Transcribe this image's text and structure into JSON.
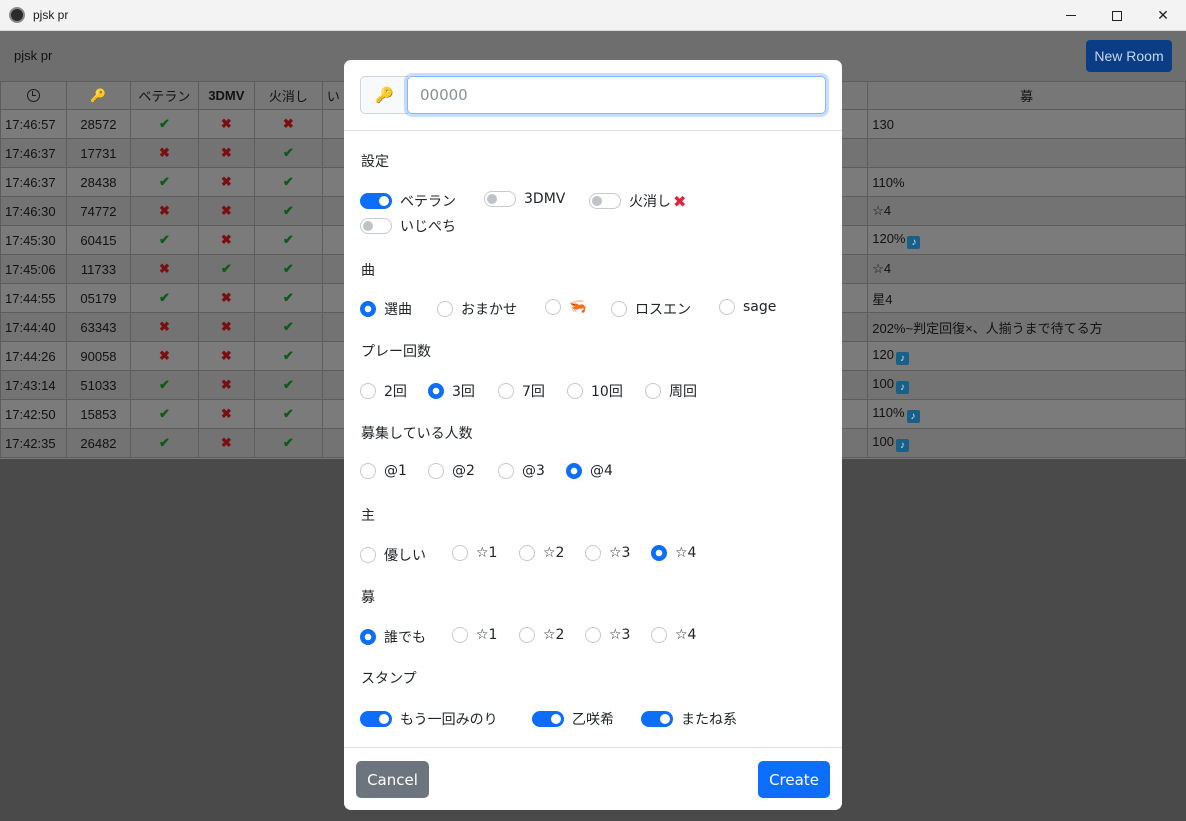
{
  "window": {
    "title": "pjsk pr"
  },
  "appbar": {
    "brand": "pjsk pr",
    "new_room_label": "New Room"
  },
  "table": {
    "headers": [
      "",
      "",
      "ベテラン",
      "3DMV",
      "火消し",
      "い",
      "募"
    ],
    "rows": [
      {
        "time": "17:46:57",
        "key": "28572",
        "veteran": true,
        "mv": false,
        "fire": false,
        "note": "130",
        "badge": false
      },
      {
        "time": "17:46:37",
        "key": "17731",
        "veteran": false,
        "mv": false,
        "fire": true,
        "note": "",
        "badge": false
      },
      {
        "time": "17:46:37",
        "key": "28438",
        "veteran": true,
        "mv": false,
        "fire": true,
        "note": "110%",
        "badge": false
      },
      {
        "time": "17:46:30",
        "key": "74772",
        "veteran": false,
        "mv": false,
        "fire": true,
        "note": "☆4",
        "badge": false
      },
      {
        "time": "17:45:30",
        "key": "60415",
        "veteran": true,
        "mv": false,
        "fire": true,
        "note": "120%",
        "badge": true
      },
      {
        "time": "17:45:06",
        "key": "11733",
        "veteran": false,
        "mv": true,
        "fire": true,
        "note": "☆4",
        "badge": false
      },
      {
        "time": "17:44:55",
        "key": "05179",
        "veteran": true,
        "mv": false,
        "fire": true,
        "note": "星4",
        "badge": false
      },
      {
        "time": "17:44:40",
        "key": "63343",
        "veteran": false,
        "mv": false,
        "fire": true,
        "note": "202%~判定回復×、人揃うまで待てる方",
        "badge": false
      },
      {
        "time": "17:44:26",
        "key": "90058",
        "veteran": false,
        "mv": false,
        "fire": true,
        "note": "120",
        "badge": true
      },
      {
        "time": "17:43:14",
        "key": "51033",
        "veteran": true,
        "mv": false,
        "fire": true,
        "note": "100",
        "badge": true
      },
      {
        "time": "17:42:50",
        "key": "15853",
        "veteran": true,
        "mv": false,
        "fire": true,
        "note": "110%",
        "badge": true
      },
      {
        "time": "17:42:35",
        "key": "26482",
        "veteran": true,
        "mv": false,
        "fire": true,
        "note": "100",
        "badge": true
      }
    ]
  },
  "modal": {
    "key_input": {
      "value": "",
      "placeholder": "00000"
    },
    "settings": {
      "title": "設定",
      "opt1": "ベテラン",
      "opt2": "3DMV",
      "opt3": "火消し",
      "opt4": "いじぺち"
    },
    "song": {
      "title": "曲",
      "opt1": "選曲",
      "opt2": "おまかせ",
      "opt3": "🦐",
      "opt4": "ロスエン",
      "opt5": "sage"
    },
    "plays": {
      "title": "プレー回数",
      "opt1": "2回",
      "opt2": "3回",
      "opt3": "7回",
      "opt4": "10回",
      "opt5": "周回"
    },
    "recruit_count": {
      "title": "募集している人数",
      "opt1": "@1",
      "opt2": "@2",
      "opt3": "@3",
      "opt4": "@4"
    },
    "host": {
      "title": "主",
      "opt1": "優しい",
      "opt2": "☆1",
      "opt3": "☆2",
      "opt4": "☆3",
      "opt5": "☆4"
    },
    "recruit": {
      "title": "募",
      "opt1": "誰でも",
      "opt2": "☆1",
      "opt3": "☆2",
      "opt4": "☆3",
      "opt5": "☆4"
    },
    "stamp": {
      "title": "スタンプ",
      "opt1": "もう一回みのり",
      "opt2": "乙咲希",
      "opt3": "またね系"
    },
    "cancel_label": "Cancel",
    "create_label": "Create"
  },
  "colors": {
    "accent": "#0d6efd",
    "secondary": "#6c757d",
    "red_x": "#e0243a"
  }
}
